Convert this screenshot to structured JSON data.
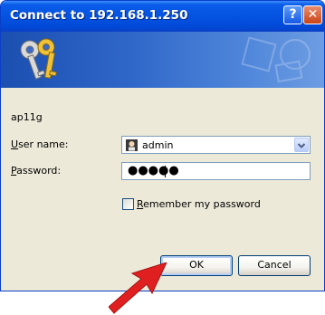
{
  "dialog": {
    "title": "Connect to 192.168.1.250",
    "help_label": "?",
    "close_label": "✕",
    "site_name": "ap11g",
    "username_label": "User name:",
    "username_accesskey": "U",
    "username_rest": "ser name:",
    "username_value": "admin",
    "password_label": "Password:",
    "password_accesskey": "P",
    "password_rest": "assword:",
    "password_mask": "●●●●●",
    "remember_label": "Remember my password",
    "remember_accesskey": "R",
    "remember_rest": "emember my password",
    "remember_checked": false,
    "ok_label": "OK",
    "cancel_label": "Cancel"
  },
  "colors": {
    "titlebar": "#0553e1",
    "dialog_bg": "#ece9d8",
    "arrow": "#e02020"
  },
  "icons": {
    "banner": "keys-icon",
    "user": "user-avatar-icon",
    "dropdown": "chevron-down-icon",
    "pointer": "red-arrow-icon"
  }
}
